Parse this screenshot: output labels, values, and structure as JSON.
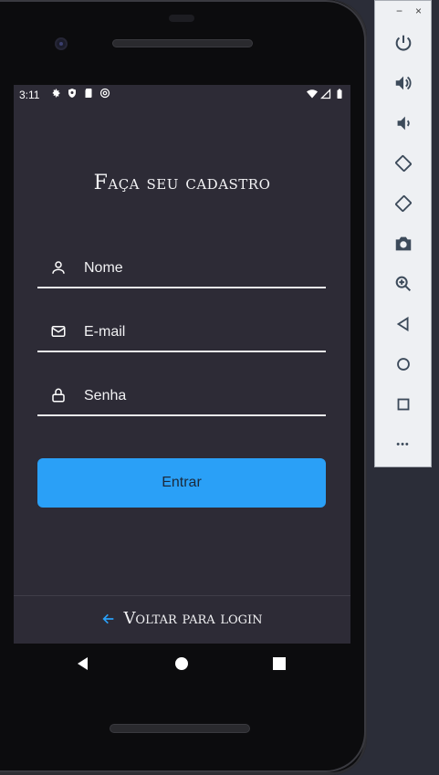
{
  "status_bar": {
    "time": "3:11"
  },
  "signup": {
    "title": "Faça seu cadastro",
    "name_placeholder": "Nome",
    "email_placeholder": "E-mail",
    "password_placeholder": "Senha",
    "submit_label": "Entrar",
    "back_label": "Voltar para login"
  },
  "emulator": {
    "minimize": "−",
    "close": "×",
    "more": "•••"
  },
  "colors": {
    "screen_bg": "#2d2b36",
    "accent": "#2aa0f7"
  }
}
